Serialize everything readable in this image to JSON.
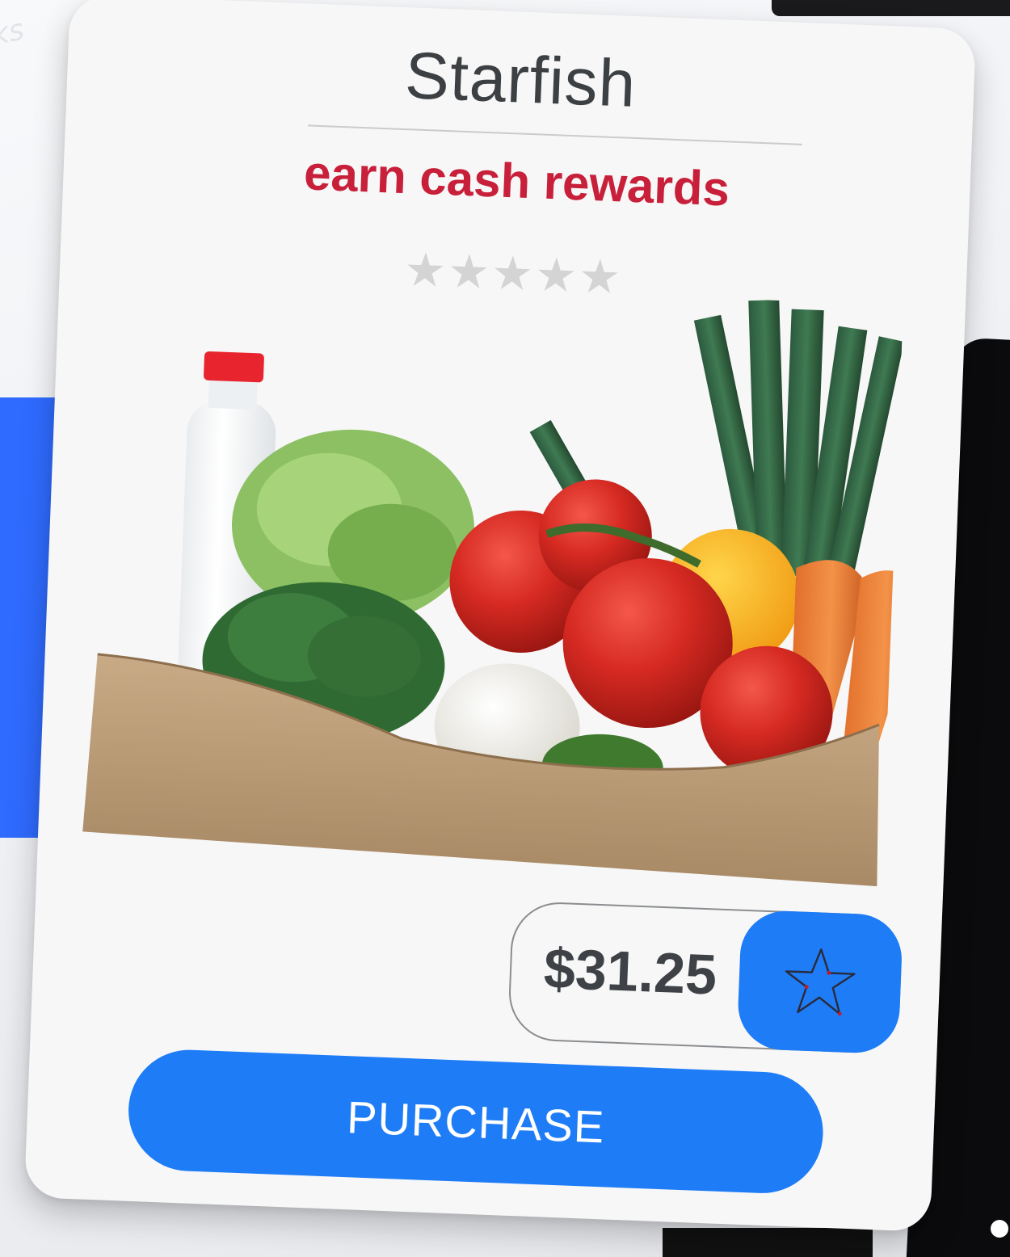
{
  "card": {
    "title": "Starfish",
    "tagline": "earn cash rewards",
    "rating": {
      "stars_filled": 0,
      "stars_total": 5,
      "star_glyph": "★★★★★"
    },
    "price": "$31.25",
    "purchase_label": "PURCHASE",
    "favorite_icon": "star-outline-icon",
    "image_subject": "grocery-bag-icon"
  },
  "background": {
    "ghost_text": "ks"
  },
  "colors": {
    "accent_blue": "#1e7cf7",
    "tagline_red": "#c8203a",
    "title_gray": "#3d4043",
    "star_gray": "#d4d4d4",
    "card_bg": "#f7f7f7"
  }
}
